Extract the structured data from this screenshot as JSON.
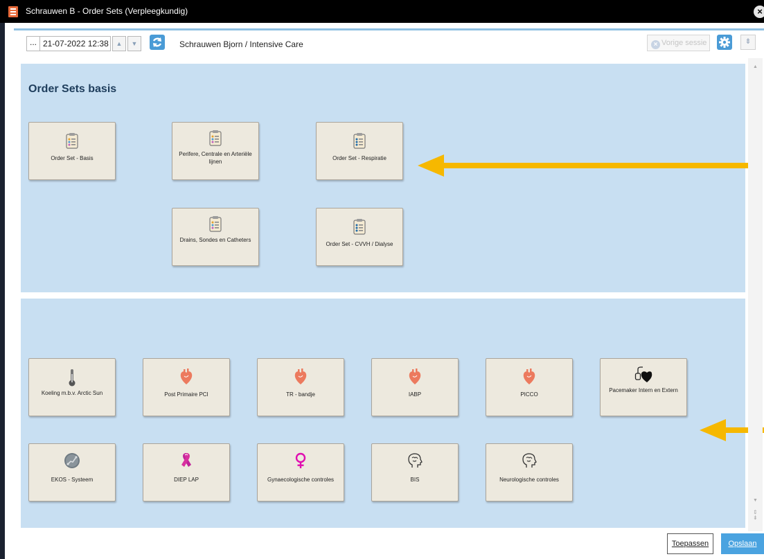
{
  "window": {
    "title": "Schrauwen B - Order Sets (Verpleegkundig)",
    "close_glyph": "×"
  },
  "toolbar": {
    "ellipsis_label": "...",
    "datetime": "21-07-2022 12:38",
    "up_glyph": "▲",
    "down_glyph": "▼",
    "patient": "Schrauwen Bjorn / Intensive Care",
    "prev_session_label": "Vorige sessie",
    "collapse_glyph": "⇟"
  },
  "panel_basis": {
    "title": "Order Sets basis",
    "tiles": [
      {
        "label": "Order Set - Basis",
        "icon": "clipboard-icon"
      },
      {
        "label": "Perifere, Centrale en Arteriële lijnen",
        "icon": "clipboard-icon"
      },
      {
        "label": "Order Set - Respiratie",
        "icon": "clipboard-icon"
      },
      {
        "label": "Drains, Sondes en Catheters",
        "icon": "clipboard-icon"
      },
      {
        "label": "Order Set - CVVH / Dialyse",
        "icon": "clipboard-icon"
      }
    ]
  },
  "panel_extra": {
    "tiles": [
      {
        "label": "Koeling m.b.v. Arctic Sun",
        "icon": "thermometer-icon"
      },
      {
        "label": "Post Primaire PCI",
        "icon": "heart-icon"
      },
      {
        "label": "TR - bandje",
        "icon": "heart-icon"
      },
      {
        "label": "IABP",
        "icon": "heart-icon"
      },
      {
        "label": "PICCO",
        "icon": "heart-icon"
      },
      {
        "label": "Pacemaker Intern en Extern",
        "icon": "pacemaker-icon"
      },
      {
        "label": "EKOS - Systeem",
        "icon": "ekos-icon"
      },
      {
        "label": "DIEP LAP",
        "icon": "ribbon-icon"
      },
      {
        "label": "Gynaecologische controles",
        "icon": "female-symbol-icon"
      },
      {
        "label": "BIS",
        "icon": "brain-icon"
      },
      {
        "label": "Neurologische controles",
        "icon": "brain-icon"
      }
    ]
  },
  "footer": {
    "apply_label": "Toepassen",
    "save_label": "Opslaan"
  },
  "colors": {
    "panel_bg": "#c8dff2",
    "tile_bg": "#ede9de",
    "arrow": "#f6b800",
    "heart": "#ec7a5e",
    "ribbon": "#c0229a",
    "female": "#e00fb0",
    "accent_blue": "#4aa3e0"
  }
}
